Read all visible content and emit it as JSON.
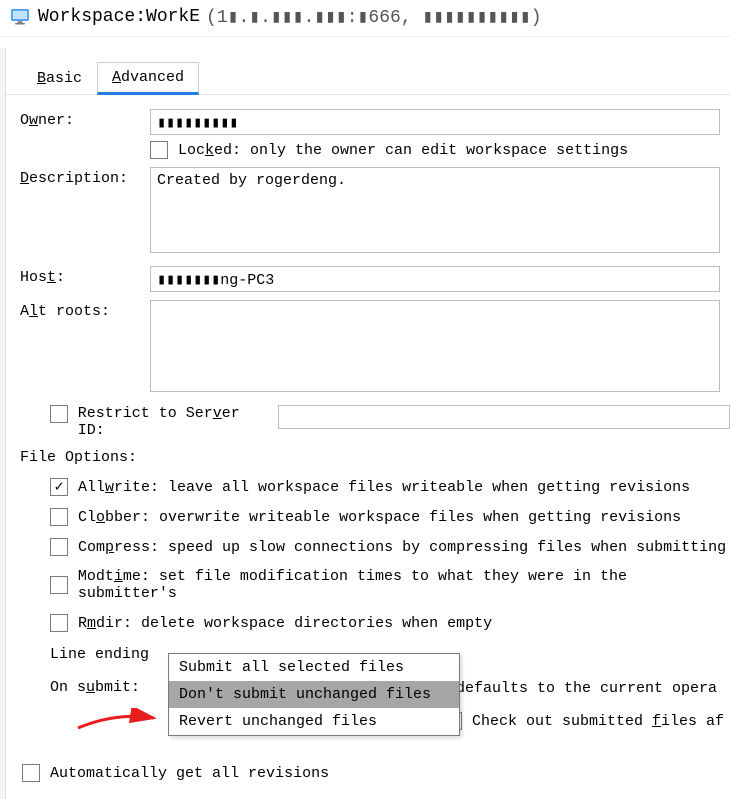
{
  "title": {
    "prefix": "Workspace: ",
    "name": "WorkE",
    "redacted_details": "(1▮.▮.▮▮▮.▮▮▮:▮666, ▮▮▮▮▮▮▮▮▮▮)"
  },
  "tabs": {
    "basic": "Basic",
    "advanced": "Advanced"
  },
  "labels": {
    "owner": "Owner:",
    "description": "Description:",
    "host": "Host:",
    "alt_roots": "Alt roots:",
    "file_options": "File Options:"
  },
  "fields": {
    "owner_value": "▮▮▮▮▮▮▮▮▮",
    "locked_label": "Locked: only the owner can edit workspace settings",
    "description_value": "Created by rogerdeng.",
    "host_value": "▮▮▮▮▮▮▮ng-PC3",
    "alt_roots_value": ""
  },
  "restrict": {
    "label": "Restrict to Server ID:",
    "value": ""
  },
  "options": {
    "allwrite": "Allwrite: leave all workspace files writeable when getting revisions",
    "clobber": "Clobber: overwrite writeable workspace files when getting revisions",
    "compress": "Compress: speed up slow connections by compressing files when submitting",
    "modtime": "Modtime: set file modification times to what they were in the submitter's",
    "rmdir": "Rmdir: delete workspace directories when empty"
  },
  "line_ending": {
    "label_visible": "Line ending",
    "tail_visible": "al: defaults to the current opera"
  },
  "on_submit": {
    "label": "On submit:",
    "dropdown": {
      "opt1": "Submit all selected files",
      "opt2": "Don't submit unchanged files",
      "opt3": "Revert unchanged files"
    },
    "checkout_label": "Check out submitted files af"
  },
  "bottom": {
    "auto_get": "Automatically get all revisions"
  },
  "checks": {
    "locked": false,
    "restrict": false,
    "allwrite": true,
    "clobber": false,
    "compress": false,
    "modtime": false,
    "rmdir": false,
    "checkout": false,
    "auto_get": false
  }
}
